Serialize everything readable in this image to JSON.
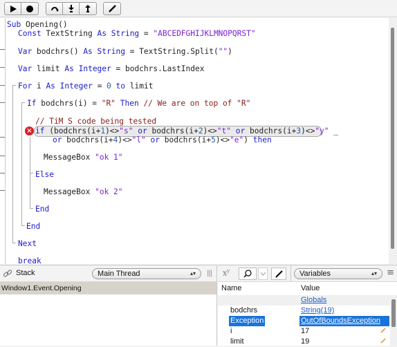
{
  "toolbar": {
    "groups": [
      {
        "buttons": [
          {
            "icon": "run-icon"
          },
          {
            "icon": "stop-icon"
          }
        ]
      },
      {
        "buttons": [
          {
            "icon": "step-over-icon"
          },
          {
            "icon": "step-into-icon"
          },
          {
            "icon": "step-out-icon"
          }
        ]
      },
      {
        "buttons": [
          {
            "icon": "edit-code-icon"
          }
        ]
      }
    ]
  },
  "editor": {
    "lines": {
      "l1_kw": "Sub",
      "l1_rest": " Opening()",
      "l2_kw1": "Const",
      "l2_a": " TextString ",
      "l2_kw2": "As",
      "l2_b": " ",
      "l2_kw3": "String",
      "l2_c": " = ",
      "l2_str": "\"ABCEDFGHIJKLMNOPQRST\"",
      "l3_kw1": "Var",
      "l3_a": " bodchrs() ",
      "l3_kw2": "As",
      "l3_b": " ",
      "l3_kw3": "String",
      "l3_c": " = TextString.Split(",
      "l3_str": "\"\"",
      "l3_d": ")",
      "l4_kw1": "Var",
      "l4_a": " limit ",
      "l4_kw2": "As",
      "l4_b": " ",
      "l4_kw3": "Integer",
      "l4_c": " = bodchrs.LastIndex",
      "l5_kw1": "For",
      "l5_a": " i ",
      "l5_kw2": "As",
      "l5_b": " ",
      "l5_kw3": "Integer",
      "l5_c": " = ",
      "l5_num": "0",
      "l5_d": " ",
      "l5_kw4": "to",
      "l5_e": " limit",
      "l6_kw1": "If",
      "l6_a": " bodchrs(i) = ",
      "l6_str": "\"R\"",
      "l6_b": " ",
      "l6_kw2": "Then",
      "l6_cmt": " // We are on top of \"R\"",
      "l7_cmt": "// TiM S code being tested",
      "l8_kw1": "if",
      "l8_a": " (bodchrs(i+",
      "l8_n1": "1",
      "l8_b": ")<>",
      "l8_s1": "\"s\"",
      "l8_c": " ",
      "l8_kw2": "or",
      "l8_d": " bodchrs(i+",
      "l8_n2": "2",
      "l8_e": ")<>",
      "l8_s2": "\"t\"",
      "l8_f": " ",
      "l8_kw3": "or",
      "l8_g": " bodchrs(i+",
      "l8_n3": "3",
      "l8_h": ")<>",
      "l8_s3": "\"y\"",
      "l8_i": " _",
      "l9_kw1": "or",
      "l9_a": " bodchrs(i+",
      "l9_n1": "4",
      "l9_b": ")<>",
      "l9_s1": "\"l\"",
      "l9_c": " ",
      "l9_kw2": "or",
      "l9_d": " bodchrs(i+",
      "l9_n2": "5",
      "l9_e": ")<>",
      "l9_s2": "\"e\"",
      "l9_f": ") ",
      "l9_kw3": "then",
      "l10_a": "MessageBox ",
      "l10_str": "\"ok 1\"",
      "l11_kw": "Else",
      "l12_a": "MessageBox ",
      "l12_str": "\"ok 2\"",
      "l13_kw": "End",
      "l14_kw": "End",
      "l15_kw": "Next",
      "l16_kw": "break"
    },
    "error_marker": "×"
  },
  "stack_panel": {
    "title": "Stack",
    "thread_select": "Main Thread",
    "frames": [
      "Window1.Event.Opening"
    ]
  },
  "variables_panel": {
    "xy_label": "x",
    "xy_sup": "y",
    "scope_select": "Variables",
    "columns": {
      "name": "Name",
      "value": "Value"
    },
    "globals_label": "Globals",
    "rows": [
      {
        "name": "bodchrs",
        "value": "String(19)",
        "link": true
      },
      {
        "name": "Exception",
        "value": "OutOfBoundsException",
        "link": true,
        "selected": true
      },
      {
        "name": "i",
        "value": "17",
        "editable": true
      },
      {
        "name": "limit",
        "value": "19",
        "editable": true
      }
    ]
  },
  "colors": {
    "keyword": "#1a1acc",
    "string": "#7a1fd8",
    "comment": "#8b1a1a",
    "selection": "#1a73d9",
    "error": "#d9202a"
  }
}
